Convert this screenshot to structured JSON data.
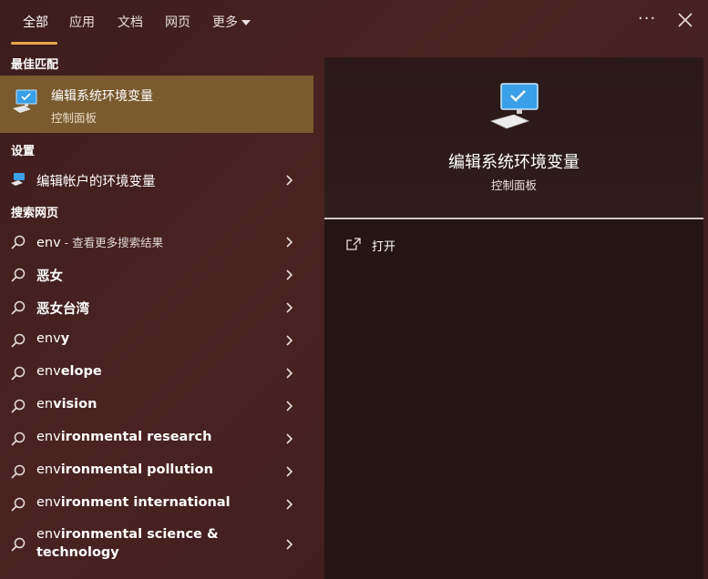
{
  "tabs": [
    {
      "label": "全部"
    },
    {
      "label": "应用"
    },
    {
      "label": "文档"
    },
    {
      "label": "网页"
    },
    {
      "label": "更多"
    }
  ],
  "header": {
    "more_options": "···"
  },
  "sections": {
    "best_match": "最佳匹配",
    "settings": "设置",
    "search_web": "搜索网页"
  },
  "best_match": {
    "title": "编辑系统环境变量",
    "subtitle": "控制面板"
  },
  "settings_item": {
    "label": "编辑帐户的环境变量"
  },
  "web_results": [
    {
      "plain": "env",
      "bold": "",
      "sub": " - 查看更多搜索结果"
    },
    {
      "plain": "",
      "bold": "恶女",
      "sub": ""
    },
    {
      "plain": "",
      "bold": "恶女台湾",
      "sub": ""
    },
    {
      "plain": "env",
      "bold": "y",
      "sub": ""
    },
    {
      "plain": "env",
      "bold": "elope",
      "sub": ""
    },
    {
      "plain": "en",
      "bold": "vision",
      "sub": ""
    },
    {
      "plain": "env",
      "bold": "ironmental research",
      "sub": ""
    },
    {
      "plain": "env",
      "bold": "ironmental pollution",
      "sub": ""
    },
    {
      "plain": "env",
      "bold": "ironment international",
      "sub": ""
    },
    {
      "plain": "env",
      "bold": "ironmental science & technology",
      "sub": ""
    }
  ],
  "preview": {
    "title": "编辑系统环境变量",
    "subtitle": "控制面板",
    "action_open": "打开"
  },
  "colors": {
    "accent": "#e9a84a",
    "selected_bg": "#7a5a2e",
    "panel_bg": "#241413"
  }
}
